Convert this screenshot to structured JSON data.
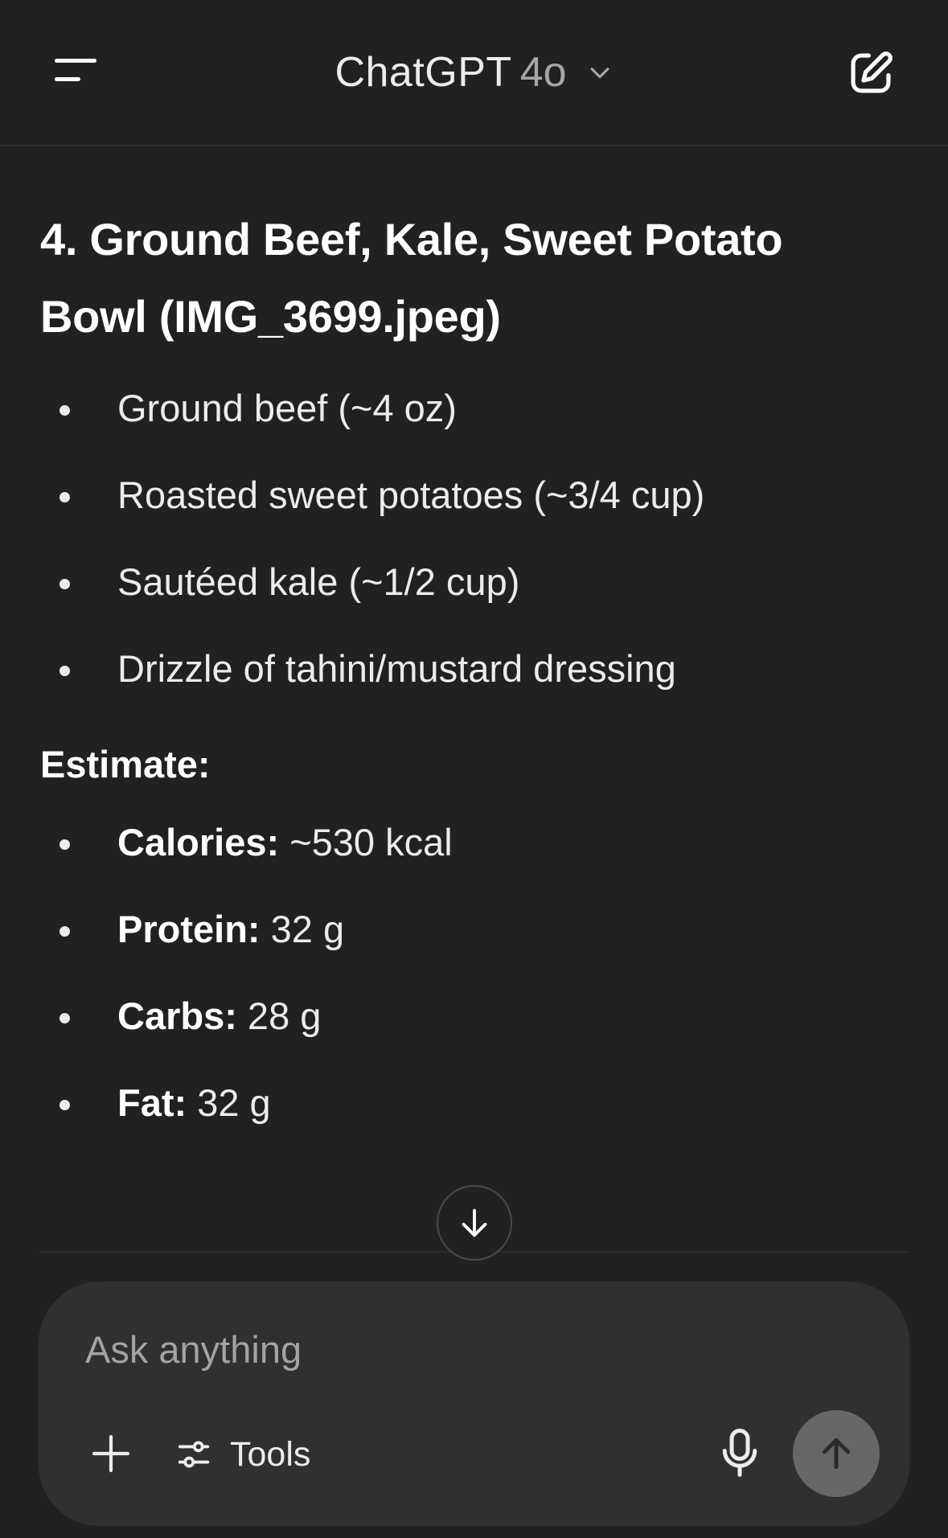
{
  "header": {
    "model_name": "ChatGPT",
    "model_version": "4o",
    "menu_icon": "menu-icon",
    "chevron_icon": "chevron-down-icon",
    "new_chat_icon": "new-chat-icon"
  },
  "message": {
    "heading_line1": "4. Ground Beef, Kale, Sweet Potato",
    "heading_line2": "Bowl (IMG_3699.jpeg)",
    "ingredients": [
      "Ground beef (~4 oz)",
      "Roasted sweet potatoes (~3/4 cup)",
      "Sautéed kale (~1/2 cup)",
      "Drizzle of tahini/mustard dressing"
    ],
    "estimate_heading": "Estimate:",
    "estimates": [
      {
        "label": "Calories:",
        "value": " ~530 kcal"
      },
      {
        "label": "Protein:",
        "value": " 32 g"
      },
      {
        "label": "Carbs:",
        "value": " 28 g"
      },
      {
        "label": "Fat:",
        "value": " 32 g"
      }
    ]
  },
  "scroll_down_icon": "arrow-down-icon",
  "composer": {
    "placeholder": "Ask anything",
    "tools_label": "Tools",
    "plus_icon": "plus-icon",
    "tools_icon": "sliders-icon",
    "mic_icon": "microphone-icon",
    "send_icon": "arrow-up-icon"
  },
  "colors": {
    "background": "#212121",
    "composer_bg": "#303030",
    "send_button_bg": "#676767",
    "text": "#ececec",
    "muted": "#a6a6a6"
  }
}
